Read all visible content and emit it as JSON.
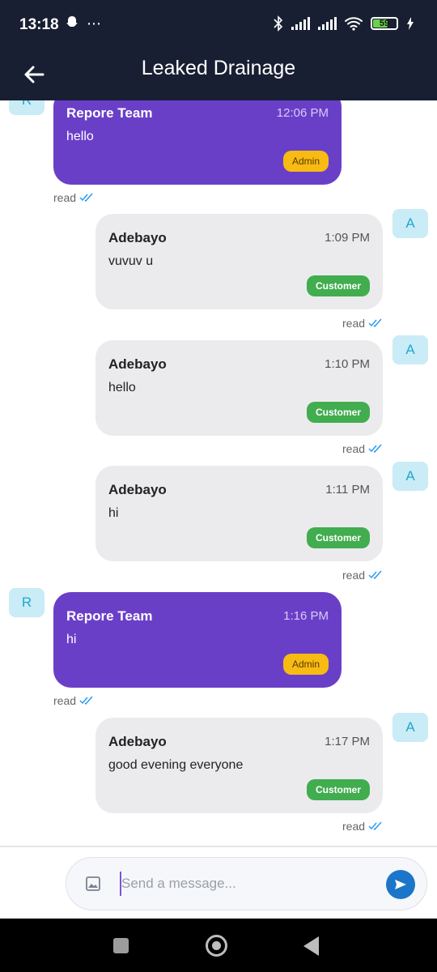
{
  "status_bar": {
    "time": "13:18",
    "left_icons": [
      "snapchat-icon",
      "more-icon"
    ],
    "battery": "59",
    "battery_fraction": 0.59
  },
  "header": {
    "title": "Leaked Drainage",
    "back_icon": "arrow-left-icon"
  },
  "messages": [
    {
      "avatar": "R",
      "sender": "Repore Team",
      "time": "12:06 PM",
      "text": "hello",
      "role": "Admin",
      "read": "read"
    },
    {
      "avatar": "A",
      "sender": "Adebayo",
      "time": "1:09 PM",
      "text": "vuvuv u",
      "role": "Customer",
      "read": "read"
    },
    {
      "avatar": "A",
      "sender": "Adebayo",
      "time": "1:10 PM",
      "text": "hello",
      "role": "Customer",
      "read": "read"
    },
    {
      "avatar": "A",
      "sender": "Adebayo",
      "time": "1:11 PM",
      "text": "hi",
      "role": "Customer",
      "read": "read"
    },
    {
      "avatar": "R",
      "sender": "Repore Team",
      "time": "1:16 PM",
      "text": "hi",
      "role": "Admin",
      "read": "read"
    },
    {
      "avatar": "A",
      "sender": "Adebayo",
      "time": "1:17 PM",
      "text": "good evening everyone",
      "role": "Customer",
      "read": "read"
    }
  ],
  "composer": {
    "placeholder": "Send a message...",
    "value": "",
    "image_icon": "image-icon",
    "send_icon": "send-icon"
  },
  "colors": {
    "header_bg": "#191f33",
    "admin_bubble": "#6a3fc8",
    "customer_bubble": "#ebebee",
    "admin_badge": "#f7bb13",
    "customer_badge": "#41ad4f",
    "send_button": "#1b76c9",
    "read_check": "#2196f3"
  }
}
